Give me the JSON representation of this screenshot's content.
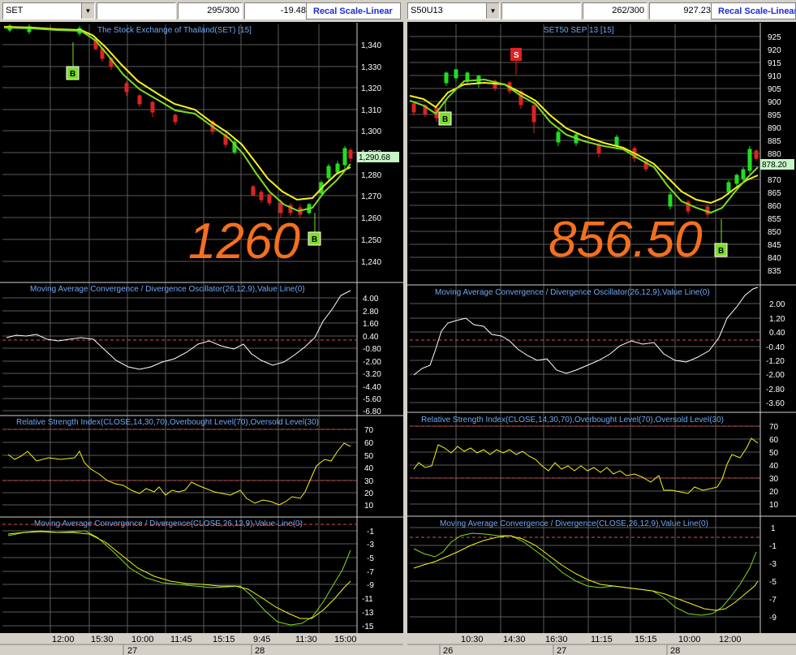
{
  "colors": {
    "background": "#000000",
    "price_up": "#22dd22",
    "price_down": "#dd2222",
    "fast_ma": "#7ddc1f",
    "slow_ma": "#f3f320",
    "signal_line": "#ffffff",
    "title_text": "#6fa8f5",
    "big_text": "#f46f1e",
    "dashed_level": "#e05050",
    "buy_marker": "#7dde2a",
    "sell_marker": "#dd2222",
    "recal_text": "#1d2bd6"
  },
  "charts": [
    {
      "symbol": "SET",
      "bar_count": "295/300",
      "change": "-19.48",
      "recal_label": "Recal Scale-Linear",
      "price_panel": {
        "title": "The Stock Exchange of Thailand(SET) [15]",
        "last_price": "1,290.68",
        "big_annotation": "1260",
        "y_ticks": [
          "1,340",
          "1,330",
          "1,320",
          "1,310",
          "1,300",
          "1,290",
          "1,280",
          "1,270",
          "1,260",
          "1,250",
          "1,240"
        ],
        "markers": [
          "B",
          "B"
        ]
      },
      "macd_osc_panel": {
        "title": "Moving Average Convergence / Divergence Oscillator(26,12,9),Value Line(0)",
        "y_ticks": [
          "4.00",
          "2.80",
          "1.60",
          "0.40",
          "-0.80",
          "-2.00",
          "-3.20",
          "-4.40",
          "-5.60",
          "-6.80"
        ]
      },
      "rsi_panel": {
        "title": "Relative Strength Index(CLOSE,14,30,70),Overbought Level(70),Oversold Level(30)",
        "y_ticks": [
          "70",
          "60",
          "50",
          "40",
          "30",
          "20",
          "10"
        ]
      },
      "macd_panel": {
        "title": "Moving Average Convergence / Divergence(CLOSE,26,12,9),Value Line(0)",
        "y_ticks": [
          "-1",
          "-3",
          "-5",
          "-7",
          "-9",
          "-11",
          "-13",
          "-15"
        ]
      },
      "time_axis": {
        "times": [
          "12:00",
          "15:30",
          "10:00",
          "11:45",
          "15:15",
          "9:45",
          "11:30",
          "15:00"
        ],
        "dates": [
          "27",
          "28"
        ]
      }
    },
    {
      "symbol": "S50U13",
      "bar_count": "262/300",
      "change": "927.23",
      "recal_label": "Recal Scale-Linear",
      "price_panel": {
        "title": "SET50 SEP 13   [15]",
        "last_price": "878.20",
        "big_annotation": "856.50",
        "y_ticks": [
          "925",
          "920",
          "915",
          "910",
          "905",
          "900",
          "895",
          "890",
          "885",
          "880",
          "875",
          "870",
          "865",
          "860",
          "855",
          "850",
          "845",
          "840",
          "835"
        ],
        "markers": [
          "S",
          "B",
          "B"
        ]
      },
      "macd_osc_panel": {
        "title": "Moving Average Convergence / Divergence Oscillator(26,12,9),Value Line(0)",
        "y_ticks": [
          "2.00",
          "1.20",
          "0.40",
          "-0.40",
          "-1.20",
          "-2.00",
          "-2.80",
          "-3.60"
        ]
      },
      "rsi_panel": {
        "title": "Relative Strength Index(CLOSE,14,30,70),Overbought Level(70),Oversold Level(30)",
        "y_ticks": [
          "70",
          "60",
          "50",
          "40",
          "30",
          "20",
          "10"
        ]
      },
      "macd_panel": {
        "title": "Moving Average Convergence / Divergence(CLOSE,26,12,9),Value Line(0)",
        "y_ticks": [
          "1",
          "-1",
          "-3",
          "-5",
          "-7",
          "-9"
        ]
      },
      "time_axis": {
        "times": [
          "10:30",
          "14:30",
          "16:30",
          "11:15",
          "15:15",
          "10:00",
          "12:00"
        ],
        "dates": [
          "26",
          "27",
          "28"
        ]
      }
    }
  ]
}
